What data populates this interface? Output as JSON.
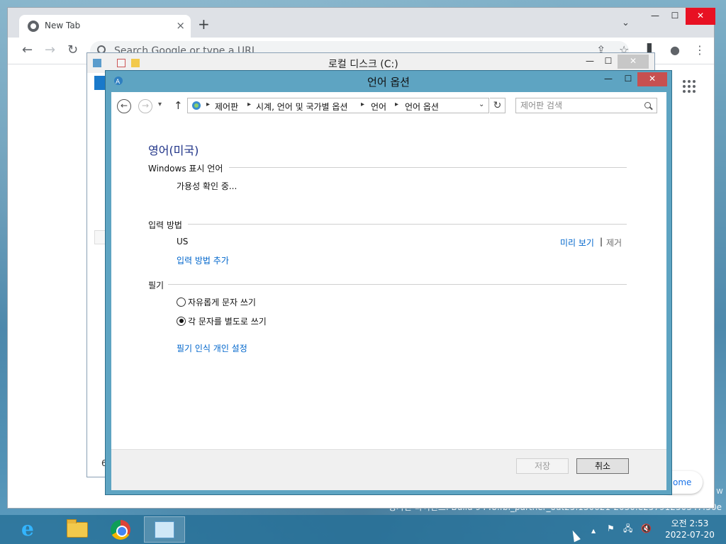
{
  "desktop": {
    "watermark": "평가판 라이선스. Build 9448.fbl_partner_out25.130621-2030.e25791250347f50e",
    "side_letter": "w"
  },
  "chrome": {
    "tab_title": "New Tab",
    "tab_close": "×",
    "new_tab": "+",
    "tab_menu": "⌄",
    "min": "—",
    "max": "☐",
    "close": "✕",
    "back": "←",
    "forward": "→",
    "reload": "↻",
    "omnibox_placeholder": "Search Google or type a URL",
    "share": "⇪",
    "star": "☆",
    "sidepanel": "▌",
    "profile": "●",
    "menu": "⋮",
    "customize_label": "ome"
  },
  "explorer": {
    "title": "로컬 디스크 (C:)",
    "min": "—",
    "max": "☐",
    "close": "✕",
    "status_fragment": "6"
  },
  "dialog": {
    "title": "언어 옵션",
    "min": "—",
    "max": "☐",
    "close": "✕",
    "address": {
      "back": "←",
      "forward": "→",
      "recent": "▾",
      "up": "↑",
      "crumbs": [
        "제어판",
        "시계, 언어 및 국가별 옵션",
        "언어",
        "언어 옵션"
      ],
      "separator": "▸",
      "dropdown": "⌄",
      "refresh": "↻"
    },
    "search_placeholder": "제어판 검색",
    "language_name": "영어(미국)",
    "display_language": {
      "title": "Windows 표시 언어",
      "status": "가용성 확인 중..."
    },
    "input_method": {
      "title": "입력 방법",
      "name": "US",
      "preview": "미리 보기",
      "pipe": "|",
      "remove": "제거",
      "add": "입력 방법 추가"
    },
    "handwriting": {
      "title": "필기",
      "options": [
        {
          "label": "자유롭게 문자 쓰기",
          "checked": false
        },
        {
          "label": "각 문자를 별도로 쓰기",
          "checked": true
        }
      ],
      "personalize": "필기 인식 개인 설정"
    },
    "save_label": "저장",
    "cancel_label": "취소"
  },
  "taskbar": {
    "apps": [
      "ie-icon",
      "folder-icon",
      "chrome-icon",
      "control-panel-icon"
    ],
    "tray": {
      "overflow": "▲",
      "flag": "⚑",
      "network": "🖧",
      "volume": "🔇"
    },
    "time": "오전 2:53",
    "date": "2022-07-20"
  }
}
